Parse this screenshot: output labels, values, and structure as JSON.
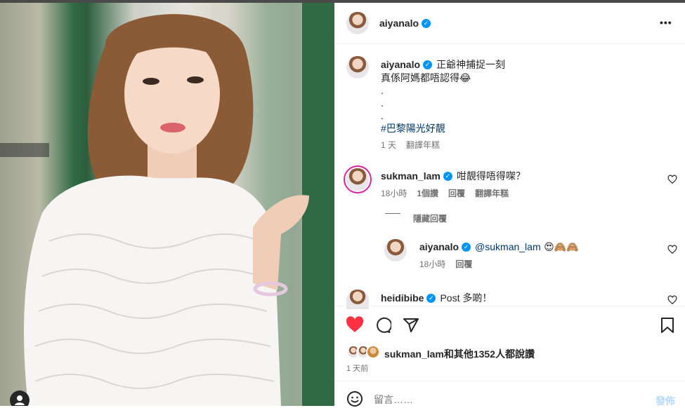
{
  "post": {
    "username": "aiyanalo",
    "more_label": "•••"
  },
  "caption": {
    "username": "aiyanalo",
    "line1": "正爺神捕捉一刻",
    "line2": "真係阿媽都唔認得😂",
    "dots": [
      ".",
      ".",
      "."
    ],
    "hashtag": "#巴黎陽光好靚",
    "time": "1 天",
    "translate": "翻譯年糕"
  },
  "comments": [
    {
      "username": "sukman_lam",
      "text": "咁靚得唔得㗎？",
      "time": "18小時",
      "likes": "1個讚",
      "reply": "回覆",
      "translate": "翻譯年糕",
      "hide_replies": "隱藏回覆"
    },
    {
      "username": "aiyanalo",
      "mention": "@sukman_lam",
      "emoji": "😍🙈🙈",
      "time": "18小時",
      "reply": "回覆"
    },
    {
      "username": "heidibibe",
      "text": "Post 多啲！"
    }
  ],
  "actions": {
    "likes_user": "sukman_lam",
    "likes_text": "和其他1352人都說讚",
    "time": "1 天前"
  },
  "composer": {
    "placeholder": "留言……",
    "post_label": "發佈"
  },
  "colors": {
    "like_red": "#ff3040",
    "link_blue": "#00376b",
    "verified_blue": "#0095f6"
  }
}
